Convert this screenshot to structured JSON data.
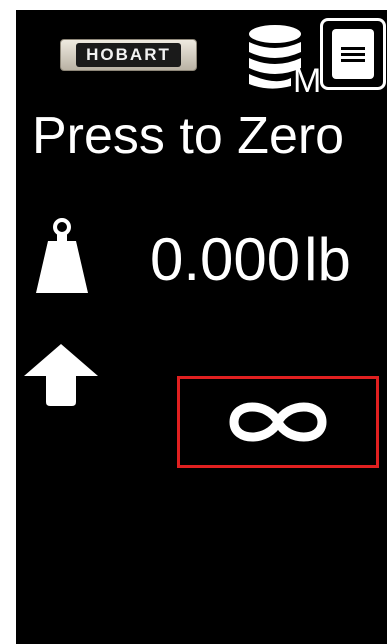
{
  "logo": {
    "text": "HOBART"
  },
  "header": {
    "db_icon": "database-m-icon",
    "db_letter": "M",
    "menu_icon": "menu-icon"
  },
  "main": {
    "title": "Press to Zero",
    "weight_icon": "weight-icon",
    "weight_value": "0.000",
    "weight_unit": "lb",
    "arrow_icon": "arrow-up-icon",
    "infinity_icon": "infinity-icon"
  },
  "colors": {
    "background": "#000000",
    "foreground": "#ffffff",
    "highlight": "#e02020"
  }
}
